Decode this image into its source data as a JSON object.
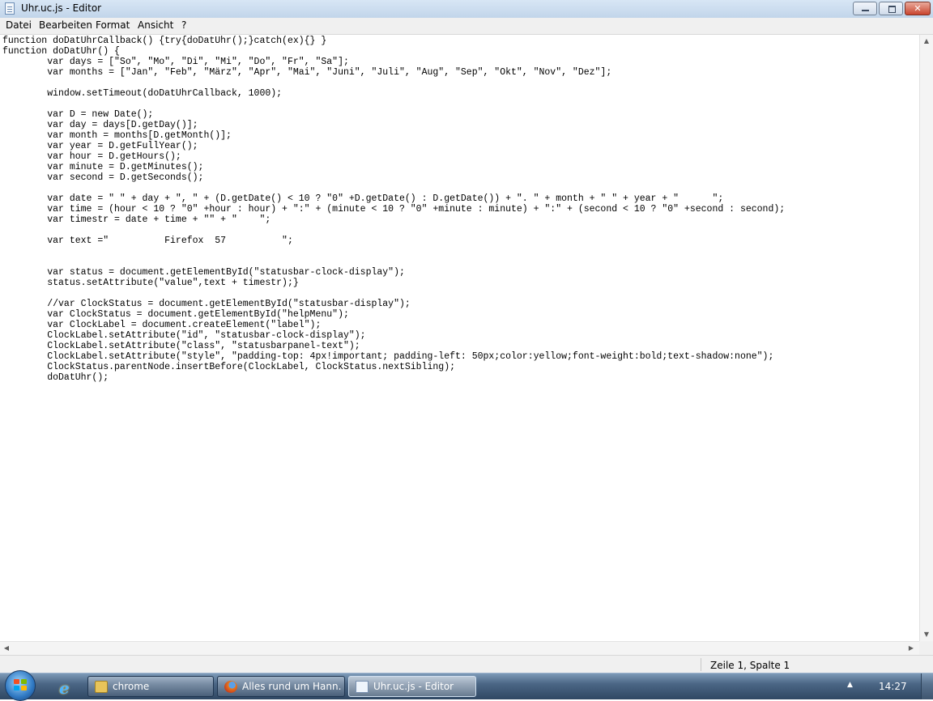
{
  "window": {
    "title": "Uhr.uc.js - Editor",
    "minimize_glyph": "",
    "maximize_glyph": "",
    "close_glyph": "✕"
  },
  "menu": {
    "items": [
      "Datei",
      "Bearbeiten",
      "Format",
      "Ansicht",
      "?"
    ]
  },
  "editor": {
    "lines": [
      "function doDatUhrCallback() {try{doDatUhr();}catch(ex){} }",
      "function doDatUhr() {",
      "        var days = [\"So\", \"Mo\", \"Di\", \"Mi\", \"Do\", \"Fr\", \"Sa\"];",
      "        var months = [\"Jan\", \"Feb\", \"März\", \"Apr\", \"Mai\", \"Juni\", \"Juli\", \"Aug\", \"Sep\", \"Okt\", \"Nov\", \"Dez\"];",
      "",
      "        window.setTimeout(doDatUhrCallback, 1000);",
      "",
      "        var D = new Date();",
      "        var day = days[D.getDay()];",
      "        var month = months[D.getMonth()];",
      "        var year = D.getFullYear();",
      "        var hour = D.getHours();",
      "        var minute = D.getMinutes();",
      "        var second = D.getSeconds();",
      "",
      "        var date = \" \" + day + \", \" + (D.getDate() < 10 ? \"0\" +D.getDate() : D.getDate()) + \". \" + month + \" \" + year + \"      \";",
      "        var time = (hour < 10 ? \"0\" +hour : hour) + \":\" + (minute < 10 ? \"0\" +minute : minute) + \":\" + (second < 10 ? \"0\" +second : second);",
      "        var timestr = date + time + \"\" + \"    \";",
      "",
      "        var text =\"          Firefox  57          \";",
      "",
      "",
      "        var status = document.getElementById(\"statusbar-clock-display\");",
      "        status.setAttribute(\"value\",text + timestr);}",
      "",
      "        //var ClockStatus = document.getElementById(\"statusbar-display\");",
      "        var ClockStatus = document.getElementById(\"helpMenu\");",
      "        var ClockLabel = document.createElement(\"label\");",
      "        ClockLabel.setAttribute(\"id\", \"statusbar-clock-display\");",
      "        ClockLabel.setAttribute(\"class\", \"statusbarpanel-text\");",
      "        ClockLabel.setAttribute(\"style\", \"padding-top: 4px!important; padding-left: 50px;color:yellow;font-weight:bold;text-shadow:none\");",
      "        ClockStatus.parentNode.insertBefore(ClockLabel, ClockStatus.nextSibling);",
      "        doDatUhr();"
    ]
  },
  "scrollbars": {
    "up": "▲",
    "down": "▼",
    "left": "◀",
    "right": "▶"
  },
  "status": {
    "position": "Zeile 1, Spalte 1"
  },
  "taskbar": {
    "tasks": [
      {
        "label": "chrome",
        "icon": "folder-icon"
      },
      {
        "label": "Alles rund um Hann...",
        "icon": "firefox-icon"
      },
      {
        "label": "Uhr.uc.js - Editor",
        "icon": "notepad-icon"
      }
    ],
    "tray_arrow": "▲",
    "clock": "14:27"
  },
  "colors": {
    "windows_flag": [
      "#f25022",
      "#7fba00",
      "#00a4ef",
      "#ffb900"
    ]
  }
}
